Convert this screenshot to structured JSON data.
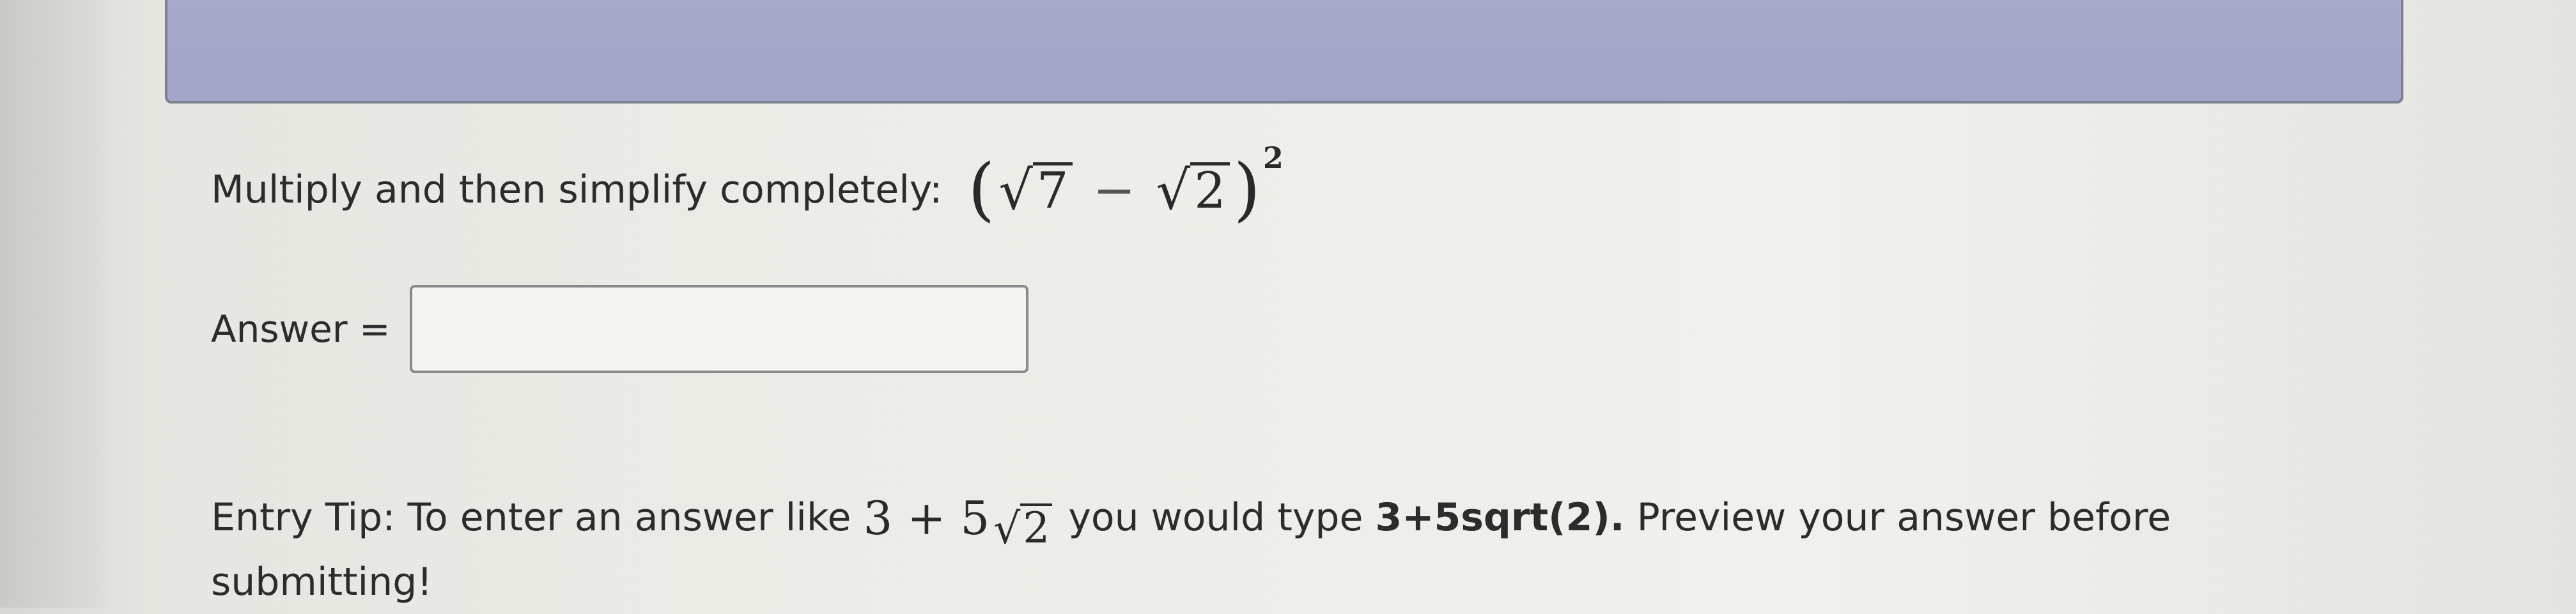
{
  "problem": {
    "instruction": "Multiply and then simplify completely:",
    "open_paren": "(",
    "sqrt_symbol": "√",
    "radicand_1": "7",
    "minus": "−",
    "radicand_2": "2",
    "close_paren": ")",
    "exponent": "2"
  },
  "answer": {
    "label": "Answer =",
    "value": "",
    "placeholder": ""
  },
  "tip": {
    "prefix": "Entry Tip: To enter an answer like",
    "example_whole": "3 + 5",
    "example_radicand": "2",
    "middle": "you would type",
    "typed_example": "3+5sqrt(2).",
    "suffix": "Preview your answer before submitting!"
  },
  "colors": {
    "banner": "#a4a7c8",
    "banner_border": "#7d7f93",
    "text": "#2c2c2c"
  }
}
